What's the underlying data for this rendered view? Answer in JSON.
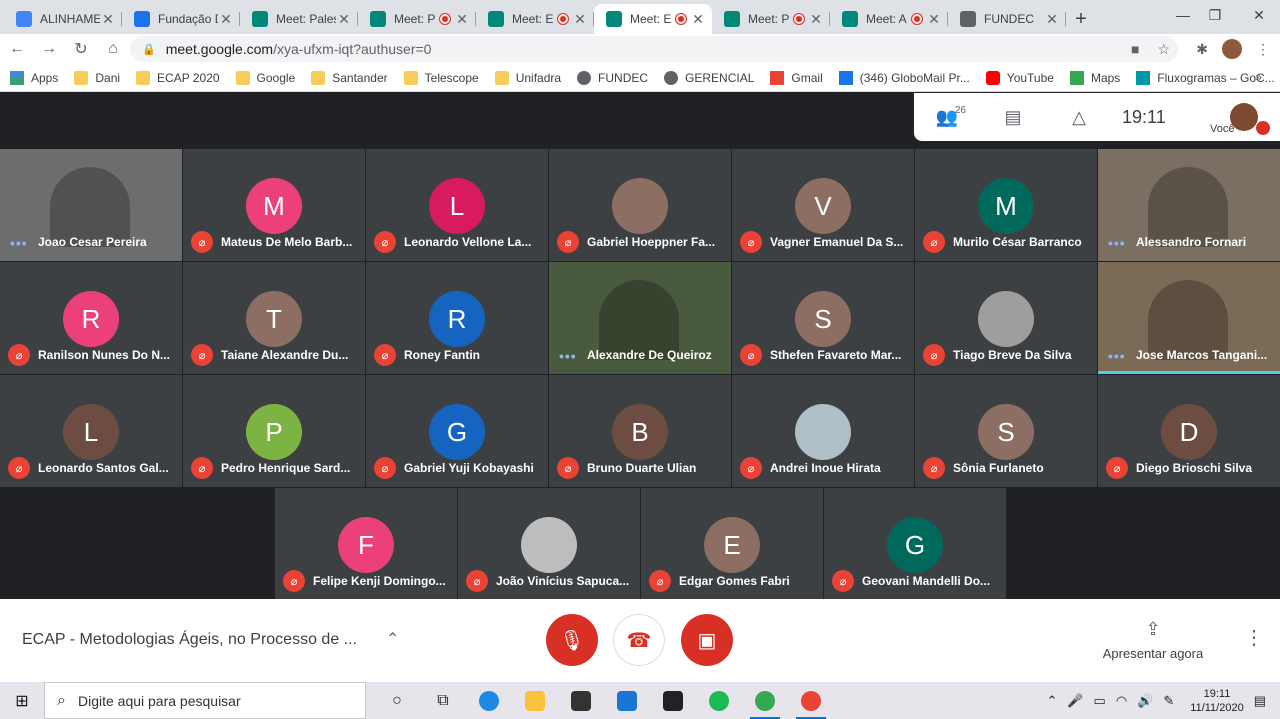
{
  "tabs": [
    {
      "title": "ALINHAME",
      "color": "#4285f4",
      "rec": false,
      "active": false,
      "icon": "docs-icon"
    },
    {
      "title": "Fundação D",
      "color": "#1a73e8",
      "rec": false,
      "active": false,
      "icon": "calendar-icon"
    },
    {
      "title": "Meet: Pales",
      "color": "#00897b",
      "rec": false,
      "active": false,
      "icon": "meet-icon"
    },
    {
      "title": "Meet: P",
      "color": "#00897b",
      "rec": true,
      "active": false,
      "icon": "meet-icon"
    },
    {
      "title": "Meet: E",
      "color": "#00897b",
      "rec": true,
      "active": false,
      "icon": "meet-icon"
    },
    {
      "title": "Meet: E",
      "color": "#00897b",
      "rec": true,
      "active": true,
      "icon": "meet-icon"
    },
    {
      "title": "Meet: P",
      "color": "#00897b",
      "rec": true,
      "active": false,
      "icon": "meet-icon"
    },
    {
      "title": "Meet: A",
      "color": "#00897b",
      "rec": true,
      "active": false,
      "icon": "meet-icon"
    },
    {
      "title": "FUNDEC",
      "color": "#5f6368",
      "rec": false,
      "active": false,
      "icon": "globe-icon"
    }
  ],
  "url": {
    "host": "meet.google.com",
    "path": "/xya-ufxm-iqt?authuser=0"
  },
  "bookmarks": [
    {
      "label": "Apps",
      "type": "apps"
    },
    {
      "label": "Dani",
      "type": "folder"
    },
    {
      "label": "ECAP 2020",
      "type": "folder"
    },
    {
      "label": "Google",
      "type": "folder"
    },
    {
      "label": "Santander",
      "type": "folder"
    },
    {
      "label": "Telescope",
      "type": "folder"
    },
    {
      "label": "Unifadra",
      "type": "folder"
    },
    {
      "label": "FUNDEC",
      "type": "globe"
    },
    {
      "label": "GERENCIAL",
      "type": "globe"
    },
    {
      "label": "Gmail",
      "type": "gmail"
    },
    {
      "label": "(346) GloboMail Pr...",
      "type": "globo"
    },
    {
      "label": "YouTube",
      "type": "youtube"
    },
    {
      "label": "Maps",
      "type": "maps"
    },
    {
      "label": "Fluxogramas – GoC...",
      "type": "flux"
    }
  ],
  "topbar": {
    "participants_count": "26",
    "time": "19:11",
    "self_label": "Você"
  },
  "participants": [
    {
      "name": "Joao Cesar Pereira",
      "initial": "",
      "color": "#6d6d6d",
      "video": true,
      "muted": false
    },
    {
      "name": "Mateus De Melo Barb...",
      "initial": "M",
      "color": "#ec407a",
      "video": false,
      "muted": true
    },
    {
      "name": "Leonardo Vellone La...",
      "initial": "L",
      "color": "#d81b60",
      "video": false,
      "muted": true
    },
    {
      "name": "Gabriel Hoeppner Fa...",
      "initial": "",
      "color": "#8d6e63",
      "video": false,
      "muted": true,
      "photo": true
    },
    {
      "name": "Vagner Emanuel Da S...",
      "initial": "V",
      "color": "#8d6e63",
      "video": false,
      "muted": true
    },
    {
      "name": "Murilo César Barranco",
      "initial": "M",
      "color": "#00695c",
      "video": false,
      "muted": true
    },
    {
      "name": "Alessandro Fornari",
      "initial": "",
      "color": "#7a6f62",
      "video": true,
      "muted": false
    },
    {
      "name": "Ranilson Nunes Do N...",
      "initial": "R",
      "color": "#ec407a",
      "video": false,
      "muted": true
    },
    {
      "name": "Taiane Alexandre Du...",
      "initial": "T",
      "color": "#8d6e63",
      "video": false,
      "muted": true
    },
    {
      "name": "Roney Fantin",
      "initial": "R",
      "color": "#1565c0",
      "video": false,
      "muted": true
    },
    {
      "name": "Alexandre De Queiroz",
      "initial": "",
      "color": "#4a5a3e",
      "video": true,
      "muted": false
    },
    {
      "name": "Sthefen Favareto Mar...",
      "initial": "S",
      "color": "#8d6e63",
      "video": false,
      "muted": true
    },
    {
      "name": "Tiago Breve Da Silva",
      "initial": "",
      "color": "#9e9e9e",
      "video": false,
      "muted": true,
      "photo": true
    },
    {
      "name": "Jose Marcos Tangani...",
      "initial": "",
      "color": "#7b6a55",
      "video": true,
      "muted": false,
      "speaking": true
    },
    {
      "name": "Leonardo Santos Gal...",
      "initial": "L",
      "color": "#6d4c41",
      "video": false,
      "muted": true
    },
    {
      "name": "Pedro Henrique Sard...",
      "initial": "P",
      "color": "#7cb342",
      "video": false,
      "muted": true
    },
    {
      "name": "Gabriel Yuji Kobayashi",
      "initial": "G",
      "color": "#1565c0",
      "video": false,
      "muted": true
    },
    {
      "name": "Bruno Duarte Ulian",
      "initial": "B",
      "color": "#6d4c41",
      "video": false,
      "muted": true
    },
    {
      "name": "Andrei Inoue Hirata",
      "initial": "",
      "color": "#b0bec5",
      "video": false,
      "muted": true,
      "photo": true
    },
    {
      "name": "Sônia Furlaneto",
      "initial": "S",
      "color": "#8d6e63",
      "video": false,
      "muted": true
    },
    {
      "name": "Diego Brioschi Silva",
      "initial": "D",
      "color": "#6d4c41",
      "video": false,
      "muted": true
    },
    {
      "name": "Felipe Kenji Domingo...",
      "initial": "F",
      "color": "#ec407a",
      "video": false,
      "muted": true
    },
    {
      "name": "João Vinícius Sapuca...",
      "initial": "",
      "color": "#bdbdbd",
      "video": false,
      "muted": true,
      "photo": true
    },
    {
      "name": "Edgar Gomes Fabri",
      "initial": "E",
      "color": "#8d6e63",
      "video": false,
      "muted": true
    },
    {
      "name": "Geovani Mandelli Do...",
      "initial": "G",
      "color": "#00695c",
      "video": false,
      "muted": true
    }
  ],
  "bottom": {
    "meeting_title": "ECAP - Metodologias Ágeis, no Processo de ...",
    "present_label": "Apresentar agora"
  },
  "taskbar": {
    "search_placeholder": "Digite aqui para pesquisar",
    "time": "19:11",
    "date": "11/11/2020"
  }
}
